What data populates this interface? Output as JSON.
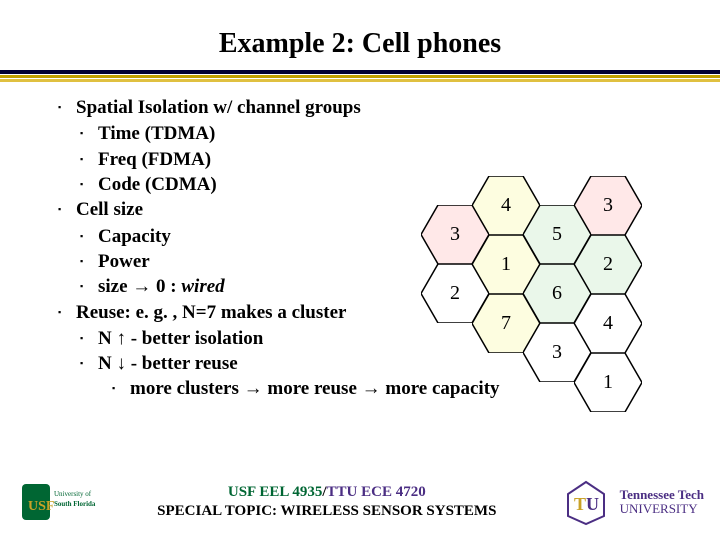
{
  "title": "Example 2: Cell phones",
  "bullets": {
    "b1": "Spatial Isolation w/ channel groups",
    "b1a": "Time (TDMA)",
    "b1b": "Freq (FDMA)",
    "b1c": "Code (CDMA)",
    "b2": "Cell size",
    "b2a": "Capacity",
    "b2b": "Power",
    "b2c_pre": "size ",
    "b2c_arrow": "→",
    "b2c_mid": " 0 : ",
    "b2c_ital": "wired",
    "b3": "Reuse: e. g. , N=7 makes a cluster",
    "b3a_pre": "N ",
    "b3a_arrow": "↑",
    "b3a_post": "  - better isolation",
    "b3b_pre": "N ",
    "b3b_arrow": "↓",
    "b3b_post": " - better reuse",
    "b3c": "more clusters → more reuse → more capacity"
  },
  "hex_labels": [
    "4",
    "3",
    "3",
    "5",
    "1",
    "2",
    "2",
    "6",
    "7",
    "4",
    "3",
    "1"
  ],
  "footer": {
    "line1a": "USF EEL 4935",
    "line1sep": "/",
    "line1b": "TTU ECE 4720",
    "line2": "SPECIAL TOPIC: WIRELESS SENSOR SYSTEMS",
    "ttu1": "Tennessee Tech",
    "ttu2": "UNIVERSITY",
    "usf_alt": "University of South Florida logo",
    "ttu_alt": "Tennessee Tech logo"
  },
  "chart_data": {
    "type": "diagram",
    "title": "Hexagonal cell cluster (N=7) with neighboring cells",
    "description": "Tessellated hexagons labeled with frequency-reuse group numbers; one full 7-cell cluster (1–7) plus adjacent cells from neighboring clusters (labels 1–6).",
    "cells": [
      {
        "label": 4,
        "role": "cluster",
        "fill": "lightyellow"
      },
      {
        "label": 3,
        "role": "cluster",
        "fill": "mistyrose"
      },
      {
        "label": 5,
        "role": "cluster",
        "fill": "honeydew"
      },
      {
        "label": 1,
        "role": "cluster-center",
        "fill": "lightyellow"
      },
      {
        "label": 2,
        "role": "neighbor",
        "fill": "white"
      },
      {
        "label": 2,
        "role": "cluster",
        "fill": "honeydew"
      },
      {
        "label": 6,
        "role": "cluster",
        "fill": "honeydew"
      },
      {
        "label": 7,
        "role": "cluster",
        "fill": "lightyellow"
      },
      {
        "label": 4,
        "role": "neighbor",
        "fill": "white"
      },
      {
        "label": 3,
        "role": "neighbor",
        "fill": "white"
      },
      {
        "label": 1,
        "role": "neighbor",
        "fill": "white"
      }
    ]
  }
}
